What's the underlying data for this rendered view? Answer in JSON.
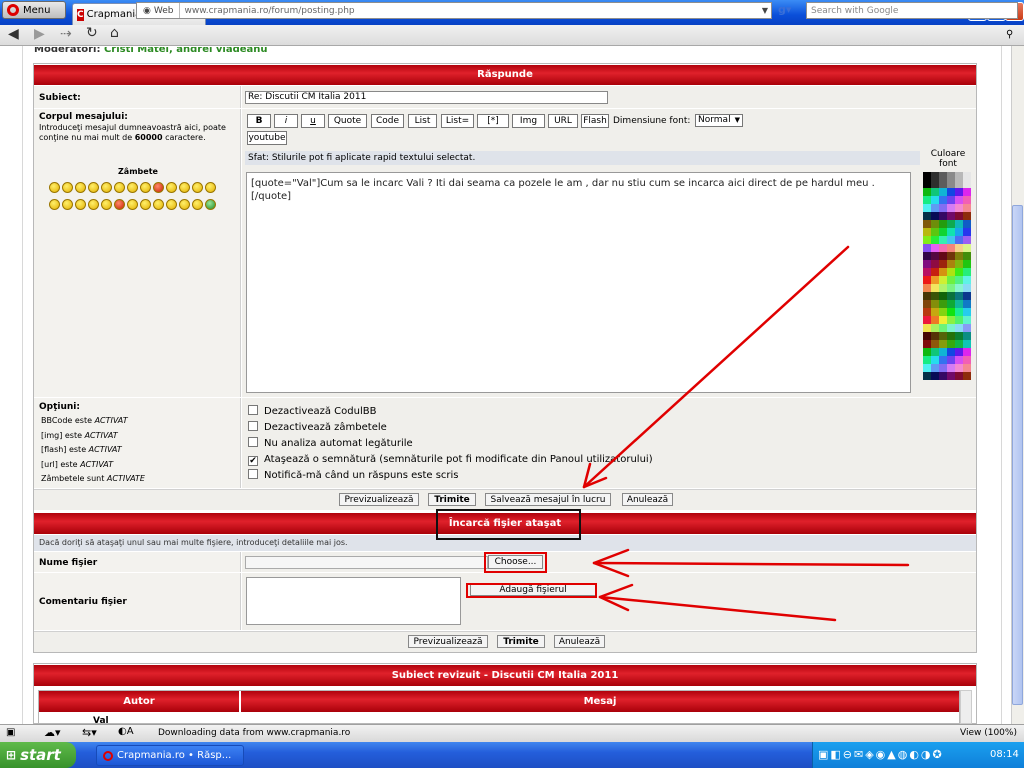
{
  "browser": {
    "menu_label": "Menu",
    "tab_title": "Crapmania.ro • Răspunde",
    "address_mode": "Web",
    "url": "www.crapmania.ro/forum/posting.php",
    "search_placeholder": "Search with Google"
  },
  "moderators": {
    "label": "Moderatori:",
    "names": "Cristi Matei, andrei vladeanu"
  },
  "form": {
    "header": "Răspunde",
    "subject_label": "Subiect:",
    "subject_value": "Re: Discutii CM Italia 2011",
    "body_label": "Corpul mesajului:",
    "body_desc": "Introduceţi mesajul dumneavoastră aici, poate conţine nu mai mult de",
    "body_limit": "60000",
    "body_desc_end": "caractere.",
    "smilies_label": "Zâmbete",
    "format_buttons": [
      "B",
      "i",
      "u",
      "Quote",
      "Code",
      "List",
      "List=",
      "[*]",
      "Img",
      "URL",
      "Flash"
    ],
    "youtube_label": "youtube",
    "font_size_label": "Dimensiune font:",
    "font_size_value": "Normal",
    "tip": "Sfat: Stilurile pot fi aplicate rapid textului selectat.",
    "message": "[quote=\"Val\"]Cum sa le incarc Vali ? Iti dai seama ca pozele le am , dar nu stiu cum se incarca aici direct de pe hardul meu .[/quote]",
    "font_color_label": "Culoare font"
  },
  "options": {
    "label": "Opţiuni:",
    "status_lines": [
      {
        "name": "BBCode este",
        "state": "ACTIVAT"
      },
      {
        "name": "[img] este",
        "state": "ACTIVAT"
      },
      {
        "name": "[flash] este",
        "state": "ACTIVAT"
      },
      {
        "name": "[url] este",
        "state": "ACTIVAT"
      },
      {
        "name": "Zâmbetele sunt",
        "state": "ACTIVATE"
      }
    ],
    "checkboxes": [
      {
        "label": "Dezactivează CodulBB",
        "checked": false
      },
      {
        "label": "Dezactivează zâmbetele",
        "checked": false
      },
      {
        "label": "Nu analiza automat legăturile",
        "checked": false
      },
      {
        "label": "Ataşează o semnătură (semnăturile pot fi modificate din Panoul utilizatorului)",
        "checked": true
      },
      {
        "label": "Notifică-mă când un răspuns este scris",
        "checked": false
      }
    ]
  },
  "actions": {
    "preview": "Previzualizează",
    "submit": "Trimite",
    "save_draft": "Salvează mesajul în lucru",
    "cancel": "Anulează"
  },
  "attachment": {
    "header": "Încarcă fişier ataşat",
    "info": "Dacă doriţi să ataşaţi unul sau mai multe fişiere, introduceţi detaliile mai jos.",
    "file_label": "Nume fişier",
    "choose_label": "Choose...",
    "comment_label": "Comentariu fişier",
    "add_file_label": "Adaugă fişierul"
  },
  "review": {
    "header": "Subiect revizuit - Discutii CM Italia 2011",
    "col_author": "Autor",
    "col_message": "Mesaj",
    "first_author": "Val"
  },
  "status": {
    "text": "Downloading data from www.crapmania.ro",
    "zoom": "View (100%)"
  },
  "taskbar": {
    "start_label": "start",
    "task_title": "Crapmania.ro • Răsp...",
    "clock": "08:14"
  },
  "colors": {
    "header_red": "#c8101a",
    "annotation_red": "#e00000",
    "taskbar_blue": "#245edb",
    "start_green": "#3c9a2d"
  }
}
